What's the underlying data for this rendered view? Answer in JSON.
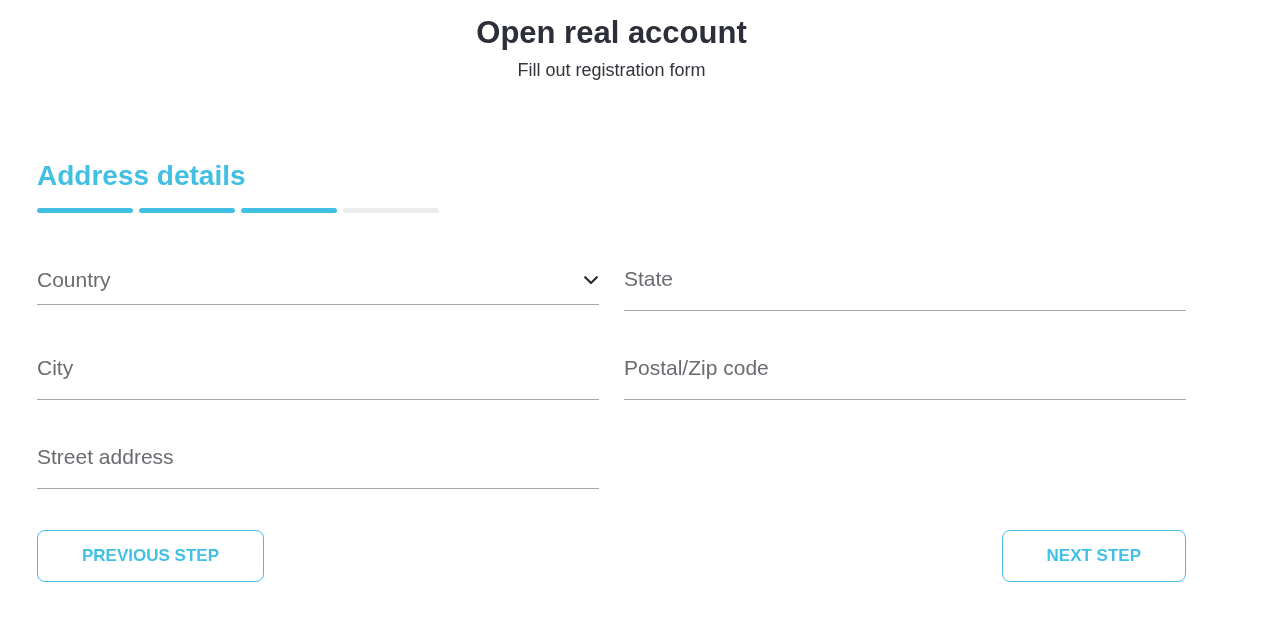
{
  "header": {
    "title": "Open real account",
    "subtitle": "Fill out registration form"
  },
  "section": {
    "heading": "Address details"
  },
  "progress_steps": [
    {
      "completed": true
    },
    {
      "completed": true
    },
    {
      "completed": true
    },
    {
      "completed": false
    }
  ],
  "fields": [
    {
      "kind": "select",
      "placeholder": "Country"
    },
    {
      "kind": "text",
      "placeholder": "State"
    },
    {
      "kind": "text",
      "placeholder": "City"
    },
    {
      "kind": "text",
      "placeholder": "Postal/Zip code"
    },
    {
      "kind": "text",
      "placeholder": "Street address"
    }
  ],
  "buttons": [
    {
      "label": "PREVIOUS STEP"
    },
    {
      "label": "NEXT STEP"
    }
  ]
}
